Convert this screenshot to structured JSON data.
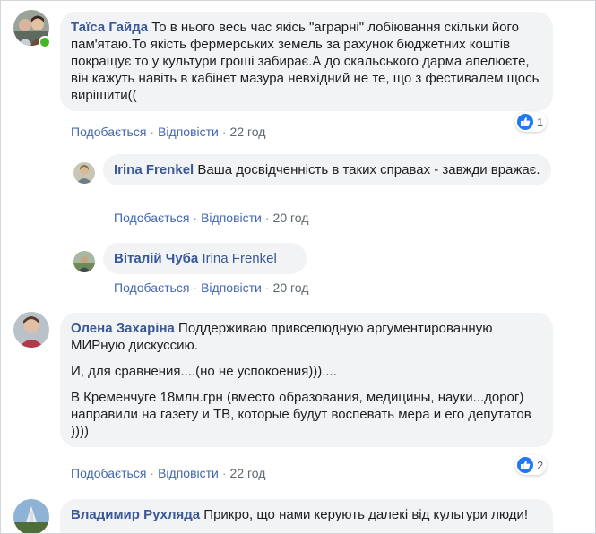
{
  "comments": [
    {
      "author": "Таїса Гайда",
      "text": "То в нього весь час якісь \"аграрні\" лобіювання скільки його пам'ятаю.То якість фермерських земель за рахунок бюджетних коштів покращує то у культури гроші забирає.А до скальського дарма апелюєте, він кажуть навіть в кабінет мазура невхідний не те, що з фестивалем щось вирішити((",
      "reaction_count": "1",
      "like": "Подобається",
      "reply": "Відповісти",
      "time": "22 год"
    },
    {
      "author": "Irina Frenkel",
      "text": "Ваша досвідченність в таких справах - завжди вражає.",
      "like": "Подобається",
      "reply": "Відповісти",
      "time": "20 год"
    },
    {
      "author": "Віталій Чуба",
      "mention": "Irina Frenkel",
      "like": "Подобається",
      "reply": "Відповісти",
      "time": "20 год"
    },
    {
      "author": "Олена Захаріна",
      "text": "Поддерживаю привселюдную аргументированную МИРную дискуссию.",
      "text2": "И, для сравнения....(но не успокоения)))....",
      "text3": "В Кременчуге 18млн.грн (вместо образования, медицины, науки...дорог) направили на газету и ТВ, которые будут воспевать мера и его депутатов ))))",
      "reaction_count": "2",
      "like": "Подобається",
      "reply": "Відповісти",
      "time": "22 год"
    },
    {
      "author": "Владимир Рухляда",
      "text": "Прикро, що нами керують далекі від культури люди!"
    }
  ],
  "colors": {
    "author": "#385898",
    "link": "#4267b2",
    "bubble": "#f2f3f5",
    "like_blue": "#2078f4",
    "online": "#42b72a"
  },
  "icons": {
    "reaction": "thumbs-up-icon",
    "presence": "online-dot-icon"
  }
}
